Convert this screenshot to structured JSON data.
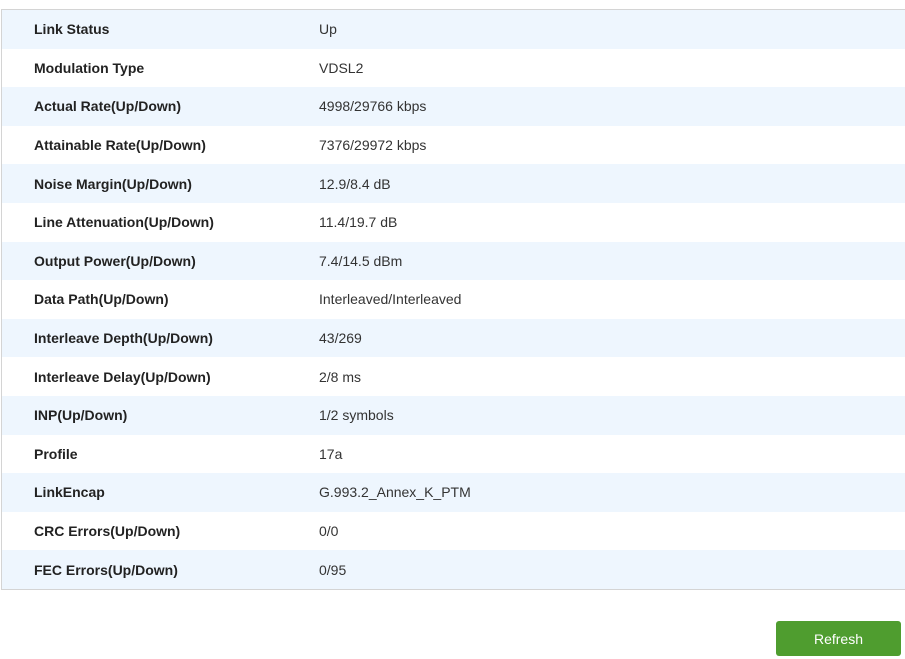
{
  "rows": [
    {
      "label": "Link Status",
      "value": "Up"
    },
    {
      "label": "Modulation Type",
      "value": "VDSL2"
    },
    {
      "label": "Actual Rate(Up/Down)",
      "value": "4998/29766 kbps"
    },
    {
      "label": "Attainable Rate(Up/Down)",
      "value": "7376/29972 kbps"
    },
    {
      "label": "Noise Margin(Up/Down)",
      "value": "12.9/8.4 dB"
    },
    {
      "label": "Line Attenuation(Up/Down)",
      "value": "11.4/19.7 dB"
    },
    {
      "label": "Output Power(Up/Down)",
      "value": "7.4/14.5 dBm"
    },
    {
      "label": "Data Path(Up/Down)",
      "value": "Interleaved/Interleaved"
    },
    {
      "label": "Interleave Depth(Up/Down)",
      "value": "43/269"
    },
    {
      "label": "Interleave Delay(Up/Down)",
      "value": "2/8 ms"
    },
    {
      "label": "INP(Up/Down)",
      "value": "1/2 symbols"
    },
    {
      "label": "Profile",
      "value": "17a"
    },
    {
      "label": "LinkEncap",
      "value": "G.993.2_Annex_K_PTM"
    },
    {
      "label": "CRC Errors(Up/Down)",
      "value": "0/0"
    },
    {
      "label": "FEC Errors(Up/Down)",
      "value": "0/95"
    }
  ],
  "refresh_label": "Refresh",
  "colors": {
    "row_alt": "#eef6fe",
    "button": "#4f9d2f"
  }
}
